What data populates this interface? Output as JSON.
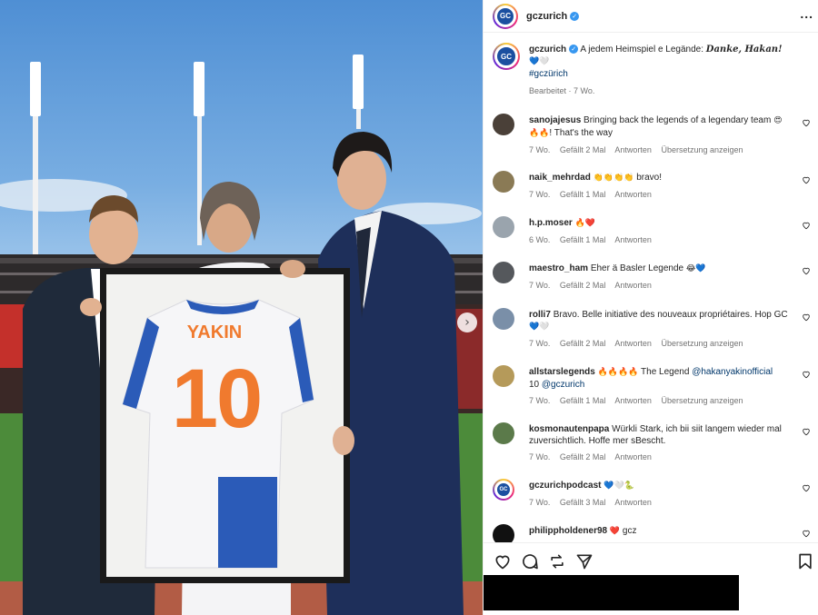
{
  "post": {
    "username": "gczurich",
    "logo_text": "GC",
    "more_label": "...",
    "caption_user": "gczurich",
    "caption_text": "A jedem Heimspiel e Legände:",
    "caption_bold": "Danke, Hakan!",
    "caption_hashtag": "#gczürich",
    "caption_meta": "Bearbeitet · 7 Wo.",
    "jersey_name": "YAKIN",
    "jersey_number": "10",
    "next_label": "›"
  },
  "comments": [
    {
      "user": "sanojajesus",
      "text": "Bringing back the legends of a legendary team",
      "emoji1": "😍",
      "emoji2": "🔥🔥",
      "text2": "! That's the way",
      "age": "7 Wo.",
      "likes": "Gefällt 2 Mal",
      "reply": "Antworten",
      "translate": "Übersetzung anzeigen"
    },
    {
      "user": "naik_mehrdad",
      "emoji": "👏👏👏👏",
      "text": "bravo!",
      "age": "7 Wo.",
      "likes": "Gefällt 1 Mal",
      "reply": "Antworten"
    },
    {
      "user": "h.p.moser",
      "emoji": "🔥❤️",
      "age": "6 Wo.",
      "likes": "Gefällt 1 Mal",
      "reply": "Antworten"
    },
    {
      "user": "maestro_ham",
      "text": "Eher ä Basler Legende",
      "emoji": "😂💙",
      "age": "7 Wo.",
      "likes": "Gefällt 2 Mal",
      "reply": "Antworten"
    },
    {
      "user": "rolli7",
      "text": "Bravo. Belle initiative des nouveaux propriétaires. Hop GC",
      "emoji": "💙🤍",
      "age": "7 Wo.",
      "likes": "Gefällt 2 Mal",
      "reply": "Antworten",
      "translate": "Übersetzung anzeigen"
    },
    {
      "user": "allstarslegends",
      "emoji": "🔥🔥🔥🔥",
      "text": "The Legend",
      "mention": "@hakanyakinofficial",
      "text2": "10",
      "mention2": "@gczurich",
      "age": "7 Wo.",
      "likes": "Gefällt 1 Mal",
      "reply": "Antworten",
      "translate": "Übersetzung anzeigen"
    },
    {
      "user": "kosmonautenpapa",
      "text": "Würkli Stark, ich bii siit langem wieder mal zuversichtlich. Hoffe mer sBescht.",
      "age": "7 Wo.",
      "likes": "Gefällt 2 Mal",
      "reply": "Antworten"
    },
    {
      "user": "gczurichpodcast",
      "emoji": "💙🤍🐍",
      "age": "7 Wo.",
      "likes": "Gefällt 3 Mal",
      "reply": "Antworten"
    },
    {
      "user": "philippholdener98",
      "emoji": "❤️",
      "text": "gcz"
    }
  ],
  "colors": {
    "accent_link": "#00376b",
    "verified": "#3797f0",
    "meta_gray": "#737373",
    "club_blue": "#1b4fa0",
    "jersey_orange": "#f07a2e"
  },
  "icons": [
    "heart-icon",
    "comment-icon",
    "share-icon",
    "send-icon",
    "bookmark-icon",
    "more-icon",
    "verified-icon"
  ]
}
